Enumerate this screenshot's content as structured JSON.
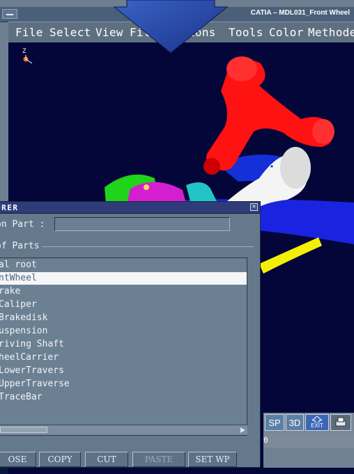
{
  "window": {
    "title": "CATIA – MDL031_Front Wheel"
  },
  "menubar": [
    "File",
    "Select",
    "View",
    "Fil",
    "ions",
    "Tools",
    "Color",
    "Methoden"
  ],
  "compass": {
    "axis_label": "Z"
  },
  "toolbar": {
    "sp": "SP",
    "three_d": "3D",
    "exit": "EXIT"
  },
  "status": {
    "text": "0"
  },
  "explorer": {
    "title": "ORER",
    "close_glyph": "✕",
    "part_label": "on Part :",
    "part_value": "",
    "group_label": "of Parts",
    "items": [
      "al root",
      "ntWheel",
      "rake",
      " Caliper",
      " Brakedisk",
      "uspension",
      "riving Shaft",
      "heelCarrier",
      " LowerTravers",
      " UpperTraverse",
      " TraceBar"
    ],
    "selected_index": 1,
    "buttons": [
      "OSE",
      "COPY",
      "CUT",
      "PASTE",
      "SET WP"
    ]
  },
  "colors": {
    "viewport_bg": "#04063a",
    "suspension_arm": "#ff1010",
    "selection": "#f5f6f8",
    "arrow": "#1f3f9c"
  },
  "icons": {
    "arrow": "down-arrow-icon",
    "close": "close-icon",
    "exit": "exit-icon",
    "printer": "printer-icon"
  }
}
